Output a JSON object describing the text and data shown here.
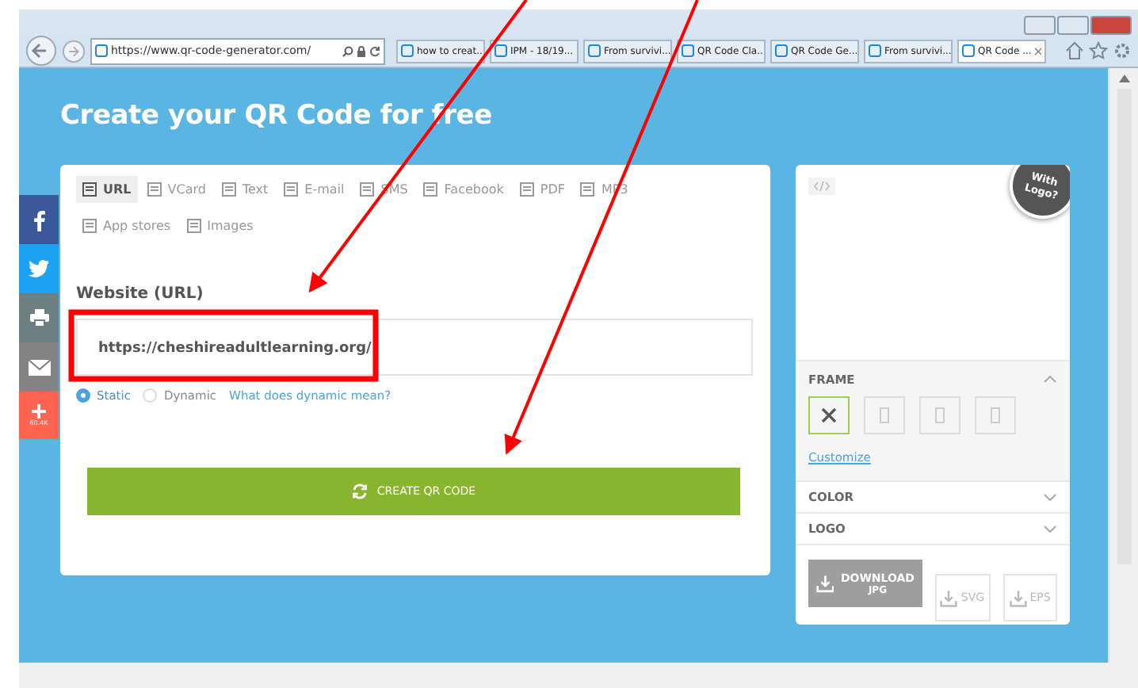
{
  "browser": {
    "address": "https://www.qr-code-generator.com/",
    "tabs": [
      {
        "label": "how to creat...",
        "selected": false
      },
      {
        "label": "IPM - 18/19...",
        "selected": false
      },
      {
        "label": "From survivi...",
        "selected": false
      },
      {
        "label": "QR Code Cla...",
        "selected": false
      },
      {
        "label": "QR Code Ge...",
        "selected": false
      },
      {
        "label": "From survivi...",
        "selected": false
      },
      {
        "label": "QR Code ...",
        "selected": true
      }
    ]
  },
  "page": {
    "title": "Create your QR Code for free",
    "share": {
      "count": "60.4K"
    },
    "types": [
      {
        "label": "URL",
        "selected": true
      },
      {
        "label": "VCard",
        "selected": false
      },
      {
        "label": "Text",
        "selected": false
      },
      {
        "label": "E-mail",
        "selected": false
      },
      {
        "label": "SMS",
        "selected": false
      },
      {
        "label": "Facebook",
        "selected": false
      },
      {
        "label": "PDF",
        "selected": false
      },
      {
        "label": "MP3",
        "selected": false
      },
      {
        "label": "App stores",
        "selected": false
      },
      {
        "label": "Images",
        "selected": false
      }
    ],
    "field_label": "Website (URL)",
    "url_value": "https://cheshireadultlearning.org/",
    "modes": [
      {
        "label": "Static",
        "selected": true
      },
      {
        "label": "Dynamic",
        "selected": false
      }
    ],
    "help_link": "What does dynamic mean?",
    "create_button": "CREATE QR CODE",
    "preview": {
      "badge": "With Logo?",
      "sections": [
        {
          "label": "FRAME",
          "expanded": true
        },
        {
          "label": "COLOR",
          "expanded": false
        },
        {
          "label": "LOGO",
          "expanded": false
        }
      ],
      "frames": [
        {
          "selected": true
        },
        {
          "selected": false
        },
        {
          "selected": false
        },
        {
          "selected": false
        }
      ],
      "customize": "Customize",
      "download": {
        "label": "DOWNLOAD",
        "format": "JPG"
      },
      "formats": [
        "SVG",
        "EPS"
      ]
    }
  }
}
